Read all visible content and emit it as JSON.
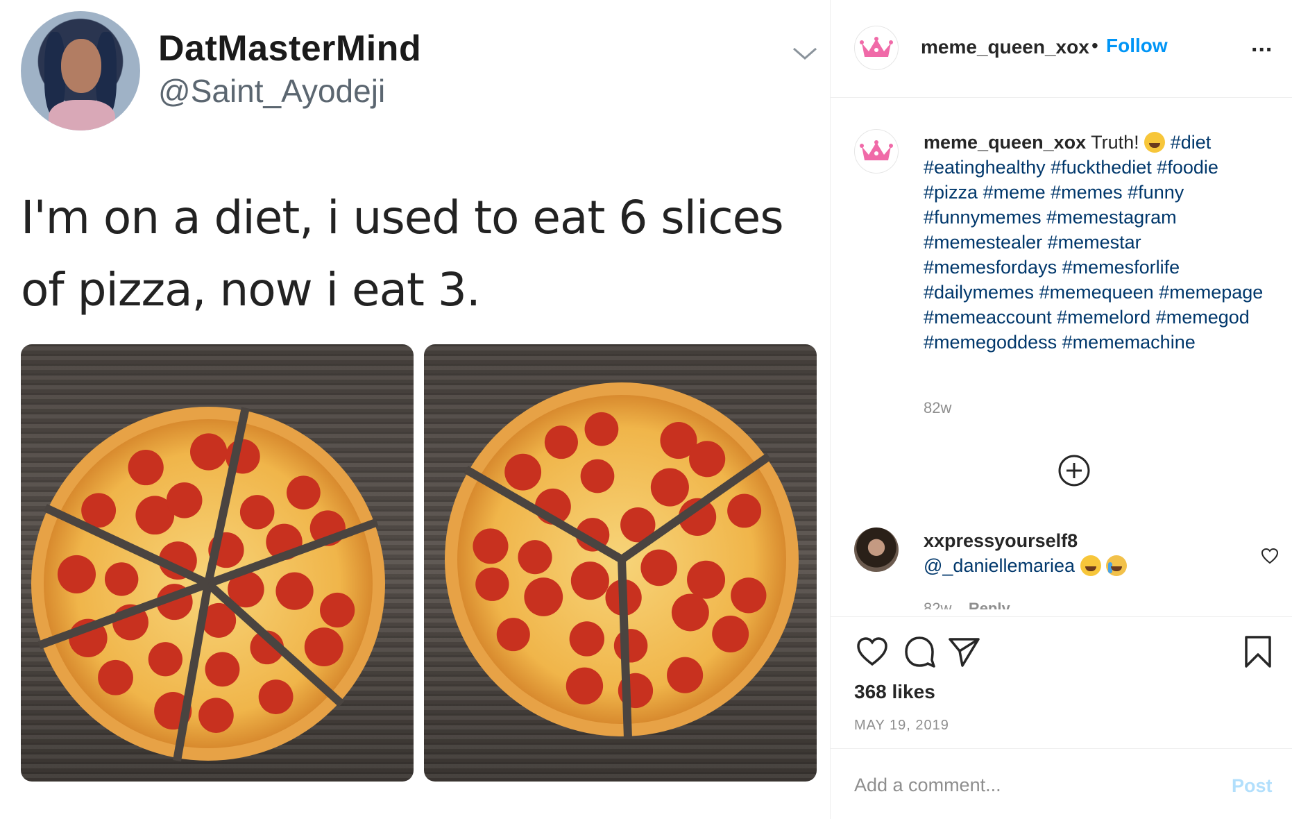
{
  "tweet": {
    "display_name": "DatMasterMind",
    "handle": "@Saint_Ayodeji",
    "text": "I'm on a diet, i used to eat 6 slices of pizza, now i eat 3."
  },
  "post": {
    "username": "meme_queen_xox",
    "separator": "•",
    "follow_label": "Follow",
    "more_label": "...",
    "caption_lead": "Truth!",
    "hashtags": [
      "#diet",
      "#eatinghealthy",
      "#fuckthediet",
      "#foodie",
      "#pizza",
      "#meme",
      "#memes",
      "#funny",
      "#funnymemes",
      "#memestagram",
      "#memestealer",
      "#memestar",
      "#memesfordays",
      "#memesforlife",
      "#dailymemes",
      "#memequeen",
      "#memepage",
      "#memeaccount",
      "#memelord",
      "#memegod",
      "#memegoddess",
      "#mememachine"
    ],
    "caption_age": "82w",
    "likes": "368 likes",
    "date": "MAY 19, 2019"
  },
  "comment": {
    "username": "xxpressyourself8",
    "text": "@_daniellemariea",
    "age": "82w",
    "reply_label": "Reply"
  },
  "composer": {
    "placeholder": "Add a comment...",
    "post_label": "Post"
  },
  "colors": {
    "link": "#0095f6",
    "hashtag": "#00376b",
    "crown": "#f06aa8"
  },
  "icons": {
    "header": [
      "crown-icon",
      "chevron-down-icon",
      "more-icon"
    ],
    "actions": [
      "heart-icon",
      "comment-icon",
      "share-icon",
      "bookmark-icon"
    ],
    "misc": [
      "plus-circle-icon",
      "comment-heart-icon"
    ]
  }
}
